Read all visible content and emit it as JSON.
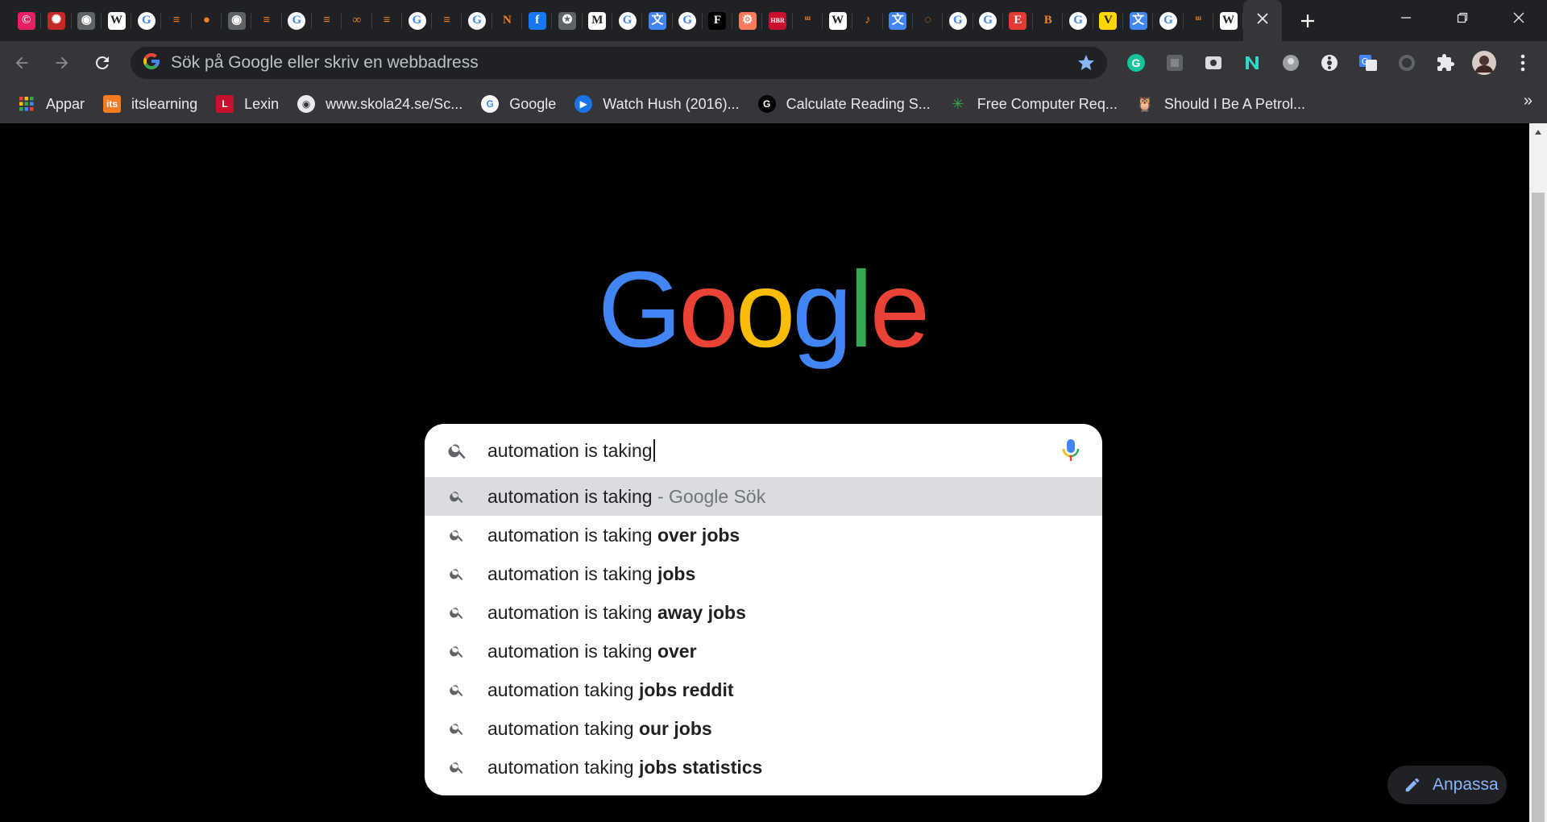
{
  "tabs": {
    "favicons": [
      {
        "name": "canva-icon",
        "glyph": "©",
        "bg": "#e91e63"
      },
      {
        "name": "starburst-icon",
        "glyph": "✺",
        "bg": "#c62828"
      },
      {
        "name": "globe-icon",
        "glyph": "◉",
        "bg": "#5f6368"
      },
      {
        "name": "wikipedia-icon",
        "glyph": "W",
        "bg": "#ffffff"
      },
      {
        "name": "google-icon",
        "glyph": "G",
        "bg": "#ffffff"
      },
      {
        "name": "stackoverflow-icon",
        "glyph": "≡",
        "bg": "#202124"
      },
      {
        "name": "github-icon",
        "glyph": "●",
        "bg": "#202124"
      },
      {
        "name": "globe-icon",
        "glyph": "◉",
        "bg": "#5f6368"
      },
      {
        "name": "stackoverflow-icon",
        "glyph": "≡",
        "bg": "#202124"
      },
      {
        "name": "google-icon",
        "glyph": "G",
        "bg": "#ffffff"
      },
      {
        "name": "stackoverflow-icon",
        "glyph": "≡",
        "bg": "#202124"
      },
      {
        "name": "infinity-icon",
        "glyph": "∞",
        "bg": "#202124"
      },
      {
        "name": "stackoverflow-icon",
        "glyph": "≡",
        "bg": "#202124"
      },
      {
        "name": "google-icon",
        "glyph": "G",
        "bg": "#ffffff"
      },
      {
        "name": "stackoverflow-icon",
        "glyph": "≡",
        "bg": "#202124"
      },
      {
        "name": "google-icon",
        "glyph": "G",
        "bg": "#ffffff"
      },
      {
        "name": "notion-icon",
        "glyph": "N",
        "bg": "#202124"
      },
      {
        "name": "facebook-icon",
        "glyph": "f",
        "bg": "#1877f2"
      },
      {
        "name": "seal-icon",
        "glyph": "✪",
        "bg": "#5f6368"
      },
      {
        "name": "gmail-icon",
        "glyph": "M",
        "bg": "#ffffff"
      },
      {
        "name": "google-icon",
        "glyph": "G",
        "bg": "#ffffff"
      },
      {
        "name": "translate-icon",
        "glyph": "文",
        "bg": "#4285f4"
      },
      {
        "name": "google-icon",
        "glyph": "G",
        "bg": "#ffffff"
      },
      {
        "name": "f-letter-icon",
        "glyph": "F",
        "bg": "#000000"
      },
      {
        "name": "hubspot-icon",
        "glyph": "⚙",
        "bg": "#ff7a59"
      },
      {
        "name": "hbr-icon",
        "glyph": "HBR",
        "bg": "#c8102e"
      },
      {
        "name": "w-brush-icon",
        "glyph": "ᵚ",
        "bg": "#202124"
      },
      {
        "name": "wikipedia-icon",
        "glyph": "W",
        "bg": "#ffffff"
      },
      {
        "name": "purple-brush-icon",
        "glyph": "♪",
        "bg": "#202124"
      },
      {
        "name": "translate-icon",
        "glyph": "文",
        "bg": "#4285f4"
      },
      {
        "name": "spinner-icon",
        "glyph": "◌",
        "bg": "#202124"
      },
      {
        "name": "google-icon",
        "glyph": "G",
        "bg": "#ffffff"
      },
      {
        "name": "google-icon",
        "glyph": "G",
        "bg": "#ffffff"
      },
      {
        "name": "e-letter-icon",
        "glyph": "E",
        "bg": "#e53935"
      },
      {
        "name": "b-letter-icon",
        "glyph": "B",
        "bg": "#202124"
      },
      {
        "name": "google-icon",
        "glyph": "G",
        "bg": "#ffffff"
      },
      {
        "name": "v-letter-icon",
        "glyph": "V",
        "bg": "#ffd600"
      },
      {
        "name": "translate-icon",
        "glyph": "文",
        "bg": "#4285f4"
      },
      {
        "name": "google-icon",
        "glyph": "G",
        "bg": "#ffffff"
      },
      {
        "name": "w-brush-icon",
        "glyph": "ᵚ",
        "bg": "#202124"
      },
      {
        "name": "wikipedia-icon",
        "glyph": "W",
        "bg": "#ffffff"
      }
    ]
  },
  "omnibox": {
    "placeholder": "Sök på Google eller skriv en webbadress"
  },
  "bookmarks": [
    {
      "label": "Appar",
      "icon": "apps-grid-icon",
      "color": "#ea4335"
    },
    {
      "label": "itslearning",
      "icon": "itslearning-icon",
      "color": "#f47b20",
      "glyph": "its"
    },
    {
      "label": "Lexin",
      "icon": "lexin-icon",
      "color": "#c8102e",
      "glyph": "L"
    },
    {
      "label": "www.skola24.se/Sc...",
      "icon": "globe-icon",
      "color": "#5f6368",
      "glyph": "◉"
    },
    {
      "label": "Google",
      "icon": "google-icon",
      "color": "#ffffff",
      "glyph": "G"
    },
    {
      "label": "Watch Hush (2016)...",
      "icon": "play-icon",
      "color": "#1a73e8",
      "glyph": "▶"
    },
    {
      "label": "Calculate Reading S...",
      "icon": "g-letter-icon",
      "color": "#000000",
      "glyph": "G"
    },
    {
      "label": "Free Computer Req...",
      "icon": "leaf-icon",
      "color": "#34a853",
      "glyph": "✳"
    },
    {
      "label": "Should I Be A Petrol...",
      "icon": "owl-icon",
      "color": "#8d6e63",
      "glyph": "🦉"
    }
  ],
  "search": {
    "query": "automation is taking",
    "suggestions": [
      {
        "prefix": "automation is taking",
        "bold": "",
        "suffix": " - Google Sök",
        "highlighted": true
      },
      {
        "prefix": "automation is taking ",
        "bold": "over jobs",
        "suffix": "",
        "highlighted": false
      },
      {
        "prefix": "automation is taking ",
        "bold": "jobs",
        "suffix": "",
        "highlighted": false
      },
      {
        "prefix": "automation is taking ",
        "bold": "away jobs",
        "suffix": "",
        "highlighted": false
      },
      {
        "prefix": "automation is taking ",
        "bold": "over",
        "suffix": "",
        "highlighted": false
      },
      {
        "prefix": "automation taking ",
        "bold": "jobs reddit",
        "suffix": "",
        "highlighted": false
      },
      {
        "prefix": "automation taking ",
        "bold": "our jobs",
        "suffix": "",
        "highlighted": false
      },
      {
        "prefix": "automation taking ",
        "bold": "jobs statistics",
        "suffix": "",
        "highlighted": false
      }
    ]
  },
  "customize": {
    "label": "Anpassa"
  },
  "colors": {
    "google_blue": "#4285f4",
    "google_red": "#ea4335",
    "google_yellow": "#fbbc05",
    "google_green": "#34a853",
    "accent_link": "#8ab4f8"
  }
}
